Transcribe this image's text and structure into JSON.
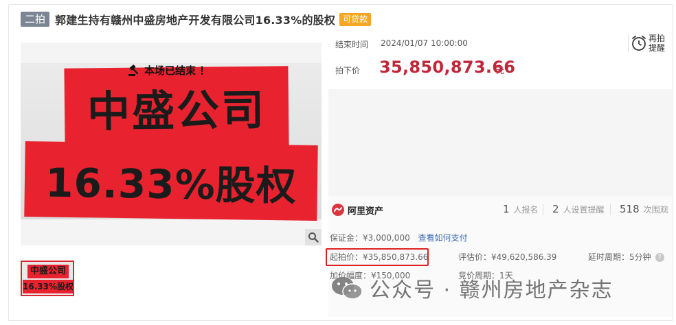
{
  "header": {
    "round_tag": "二拍",
    "title": "郭建生持有赣州中盛房地产开发有限公司16.33%的股权",
    "loan_tag": "可贷款"
  },
  "image": {
    "banner_line1": "中盛公司",
    "banner_line2": "16.33%股权",
    "thumb_line1": "中盛公司",
    "thumb_line2": "16.33%股权"
  },
  "auction": {
    "end_time_label": "结束时间",
    "end_time_value": "2024/01/07 10:00:00",
    "deal_price_label": "拍下价",
    "deal_price_value": "35,850,873.66",
    "deal_price_unit": "元",
    "remind_label": "再拍提醒",
    "status_text": "本场已结束 ！"
  },
  "platform": {
    "name": "阿里资产",
    "stats": [
      {
        "num": "1",
        "label": "人报名"
      },
      {
        "num": "2",
        "label": "人设置提醒"
      },
      {
        "num": "518",
        "label": "次围观"
      }
    ]
  },
  "details": {
    "deposit": "保证金：¥3,000,000",
    "deposit_link": "查看如何支付",
    "start_price": "起拍价：¥35,850,873.66",
    "appraisal": "评估价：¥49,620,586.39",
    "extension": "延时周期：5分钟",
    "increment": "加价幅度：¥150,000",
    "bid_period": "竞价周期：1天"
  },
  "watermark": {
    "text": "公众号 · 赣州房地产杂志"
  },
  "colors": {
    "price_red": "#c0283a",
    "highlight_red": "#e02020",
    "tag_orange": "#f5a623",
    "tag_gray": "#7b8594",
    "link_blue": "#3d6bb5"
  }
}
